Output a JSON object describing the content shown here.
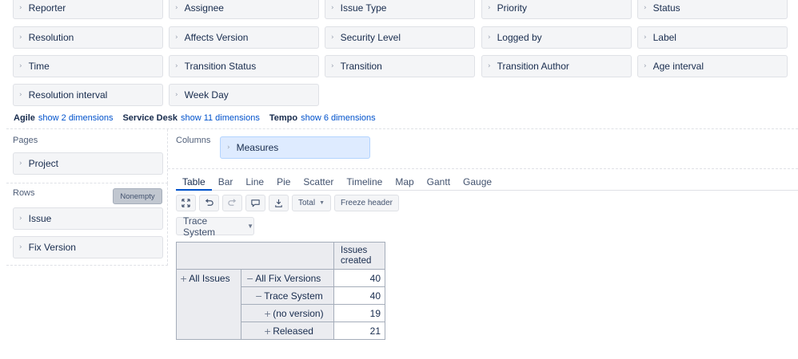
{
  "dimensions": {
    "rows": [
      [
        "Reporter",
        "Assignee",
        "Issue Type",
        "Priority",
        "Status"
      ],
      [
        "Resolution",
        "Affects Version",
        "Security Level",
        "Logged by",
        "Label"
      ],
      [
        "Time",
        "Transition Status",
        "Transition",
        "Transition Author",
        "Age interval"
      ],
      [
        "Resolution interval",
        "Week Day"
      ]
    ],
    "more": [
      {
        "name": "Agile",
        "link": "show 2 dimensions"
      },
      {
        "name": "Service Desk",
        "link": "show 11 dimensions"
      },
      {
        "name": "Tempo",
        "link": "show 6 dimensions"
      }
    ]
  },
  "pages": {
    "label": "Pages",
    "items": [
      "Project"
    ]
  },
  "rows": {
    "label": "Rows",
    "nonempty_label": "Nonempty",
    "items": [
      "Issue",
      "Fix Version"
    ]
  },
  "columns": {
    "label": "Columns",
    "items": [
      "Measures"
    ]
  },
  "tabs": [
    "Table",
    "Bar",
    "Line",
    "Pie",
    "Scatter",
    "Timeline",
    "Map",
    "Gantt",
    "Gauge"
  ],
  "active_tab": "Table",
  "toolbar": {
    "icons": [
      "fullscreen-icon",
      "undo-icon",
      "redo-icon",
      "comment-icon",
      "export-icon"
    ],
    "total_label": "Total",
    "freeze_label": "Freeze header"
  },
  "filter": {
    "selected": "Trace System"
  },
  "table": {
    "header": "Issues created",
    "rows": [
      {
        "c1": "All Issues",
        "c2": "All Fix Versions",
        "value": "40",
        "icon2": "−"
      },
      {
        "c2": "Trace System",
        "value": "40",
        "icon2": "−"
      },
      {
        "c2": "(no version)",
        "value": "19",
        "icon2": "+"
      },
      {
        "c2": "Released",
        "value": "21",
        "icon2": "+"
      }
    ]
  },
  "colors": {
    "accent": "#0052cc",
    "pill_bg": "#f4f5f7",
    "measures_bg": "#deebff"
  }
}
